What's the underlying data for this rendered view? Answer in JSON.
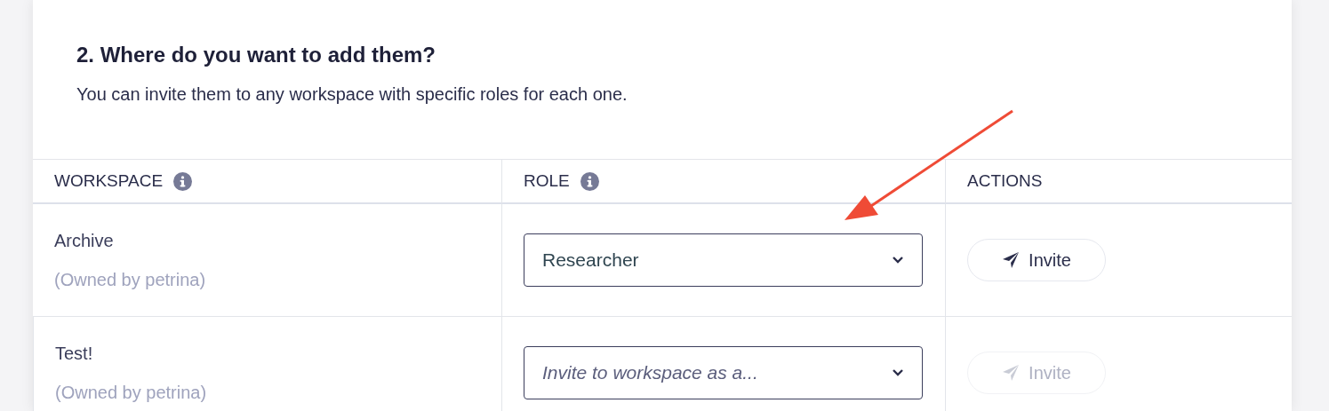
{
  "section": {
    "title": "2. Where do you want to add them?",
    "description": "You can invite them to any workspace with specific roles for each one."
  },
  "table": {
    "columns": [
      {
        "label": "WORKSPACE",
        "kind": "info"
      },
      {
        "label": "ROLE",
        "kind": "info"
      },
      {
        "label": "ACTIONS",
        "kind": "plain"
      }
    ],
    "rows": [
      {
        "workspace": "Archive",
        "owner": "(Owned by petrina)",
        "role": {
          "value": "Researcher"
        },
        "invite": {
          "label": "Invite",
          "disabled": false
        }
      },
      {
        "workspace": "Test!",
        "owner": "(Owned by petrina)",
        "role": {
          "placeholder": "Invite to workspace as a..."
        },
        "invite": {
          "label": "Invite",
          "disabled": true
        }
      }
    ]
  }
}
